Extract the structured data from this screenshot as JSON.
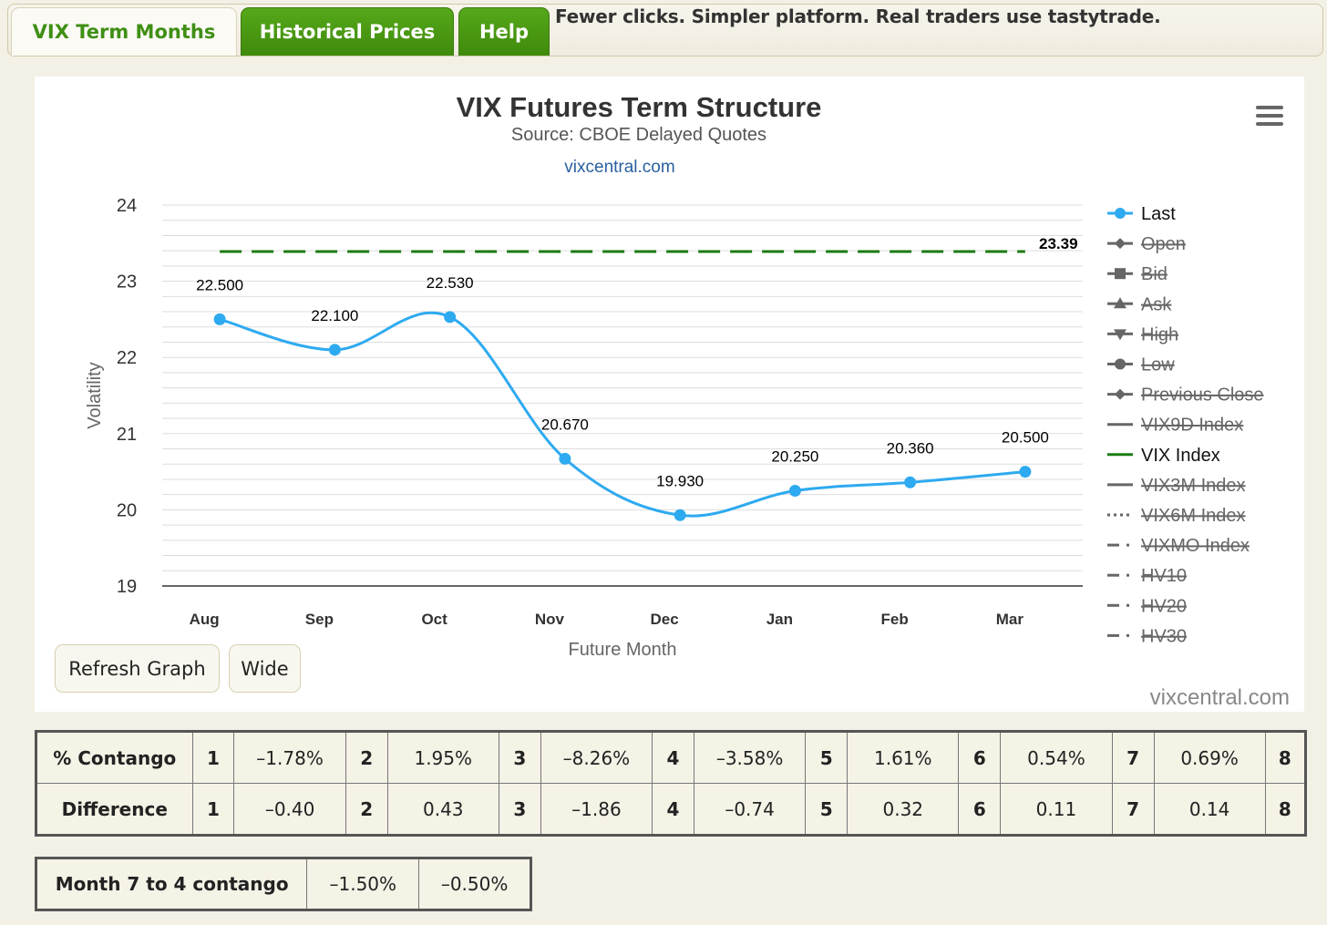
{
  "tabs": [
    {
      "label": "VIX Term Months",
      "active": true
    },
    {
      "label": "Historical Prices",
      "active": false
    },
    {
      "label": "Help",
      "active": false
    }
  ],
  "promo_text": "Fewer clicks. Simpler platform. Real traders use tastytrade.",
  "menu_icon": "hamburger-menu-icon",
  "buttons": {
    "refresh": "Refresh Graph",
    "wide": "Wide"
  },
  "watermark": "vixcentral.com",
  "colors": {
    "last_series": "#2eaaf0",
    "vix_index": "#1a7a12",
    "tab_green": "#4a9a14",
    "legend_disabled": "#666666"
  },
  "chart_data": {
    "type": "line",
    "title": "VIX Futures Term Structure",
    "subtitle": "Source: CBOE Delayed Quotes",
    "link": "vixcentral.com",
    "xlabel": "Future Month",
    "ylabel": "Volatility",
    "categories": [
      "Aug",
      "Sep",
      "Oct",
      "Nov",
      "Dec",
      "Jan",
      "Feb",
      "Mar"
    ],
    "ylim": [
      19,
      24
    ],
    "yticks": [
      19,
      20,
      21,
      22,
      23,
      24
    ],
    "minor_grid_step": 0.2,
    "grid": true,
    "legend_position": "right",
    "series": [
      {
        "name": "Last",
        "values": [
          22.5,
          22.1,
          22.53,
          20.67,
          19.93,
          20.25,
          20.36,
          20.5
        ],
        "labels": [
          "22.500",
          "22.100",
          "22.530",
          "20.670",
          "19.930",
          "20.250",
          "20.360",
          "20.500"
        ],
        "smooth": true,
        "marker": "circle"
      },
      {
        "name": "VIX Index",
        "value": 23.39,
        "label": "23.39",
        "dash": "dashed",
        "constant": true
      }
    ],
    "legend": [
      {
        "name": "Last",
        "enabled": true,
        "symbol": "circle",
        "color": "#2eaaf0"
      },
      {
        "name": "Open",
        "enabled": false,
        "symbol": "diamond"
      },
      {
        "name": "Bid",
        "enabled": false,
        "symbol": "square"
      },
      {
        "name": "Ask",
        "enabled": false,
        "symbol": "triangle"
      },
      {
        "name": "High",
        "enabled": false,
        "symbol": "triangle-down"
      },
      {
        "name": "Low",
        "enabled": false,
        "symbol": "circle"
      },
      {
        "name": "Previous Close",
        "enabled": false,
        "symbol": "diamond"
      },
      {
        "name": "VIX9D Index",
        "enabled": false,
        "symbol": "line"
      },
      {
        "name": "VIX Index",
        "enabled": true,
        "symbol": "line",
        "color": "#1a7a12"
      },
      {
        "name": "VIX3M Index",
        "enabled": false,
        "symbol": "line"
      },
      {
        "name": "VIX6M Index",
        "enabled": false,
        "symbol": "dotted"
      },
      {
        "name": "VIXMO Index",
        "enabled": false,
        "symbol": "dashdot"
      },
      {
        "name": "HV10",
        "enabled": false,
        "symbol": "dashdot"
      },
      {
        "name": "HV20",
        "enabled": false,
        "symbol": "dashdot"
      },
      {
        "name": "HV30",
        "enabled": false,
        "symbol": "dashdot"
      }
    ]
  },
  "contango_table": {
    "rows": [
      {
        "label": "% Contango",
        "cells": [
          {
            "n": "1",
            "v": "–1.78%"
          },
          {
            "n": "2",
            "v": "1.95%"
          },
          {
            "n": "3",
            "v": "–8.26%"
          },
          {
            "n": "4",
            "v": "–3.58%"
          },
          {
            "n": "5",
            "v": "1.61%"
          },
          {
            "n": "6",
            "v": "0.54%"
          },
          {
            "n": "7",
            "v": "0.69%"
          }
        ],
        "last": "8"
      },
      {
        "label": "Difference",
        "cells": [
          {
            "n": "1",
            "v": "–0.40"
          },
          {
            "n": "2",
            "v": "0.43"
          },
          {
            "n": "3",
            "v": "–1.86"
          },
          {
            "n": "4",
            "v": "–0.74"
          },
          {
            "n": "5",
            "v": "0.32"
          },
          {
            "n": "6",
            "v": "0.11"
          },
          {
            "n": "7",
            "v": "0.14"
          }
        ],
        "last": "8"
      }
    ]
  },
  "month_table": {
    "label": "Month 7 to 4 contango",
    "values": [
      "–1.50%",
      "–0.50%"
    ]
  }
}
